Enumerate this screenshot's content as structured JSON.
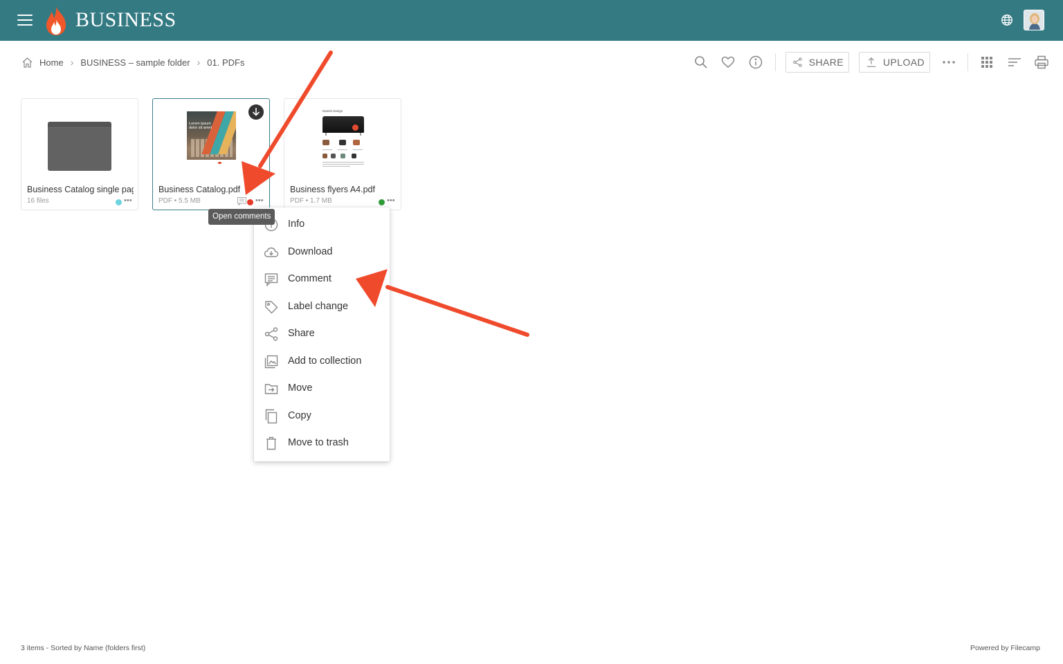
{
  "header": {
    "brand": "BUSINESS",
    "menu_icon": "hamburger-menu-icon",
    "logo_icon": "flame-logo-icon",
    "language_icon": "globe-icon",
    "colors": {
      "bar": "#347a83",
      "flame_outer": "#f0572a",
      "flame_inner": "#ffffff"
    }
  },
  "breadcrumb": {
    "items": [
      "Home",
      "BUSINESS – sample folder",
      "01. PDFs"
    ],
    "separator_icon": "chevron-right-icon"
  },
  "toolbar": {
    "share_label": "SHARE",
    "upload_label": "UPLOAD",
    "icons": [
      "search-icon",
      "heart-icon",
      "info-icon",
      "share-icon",
      "upload-icon",
      "more-horizontal-icon",
      "grid-view-icon",
      "sort-icon",
      "print-icon"
    ]
  },
  "files": [
    {
      "name": "Business Catalog single page",
      "meta": "16 files",
      "kind": "folder",
      "status_color": "#6dd4e0"
    },
    {
      "name": "Business Catalog.pdf",
      "meta": "PDF • 5.5 MB",
      "kind": "pdf",
      "status_color": "#e53a28",
      "selected": true
    },
    {
      "name": "Business flyers A4.pdf",
      "meta": "PDF • 1.7 MB",
      "kind": "pdf",
      "status_color": "#2e9b3a"
    }
  ],
  "catalog_cover_text": [
    "Lorem ipsum",
    "dolor sit amet"
  ],
  "flyer_header": "Danish Design",
  "tooltip": "Open comments",
  "context_menu": {
    "items": [
      {
        "label": "Info",
        "icon": "info-icon"
      },
      {
        "label": "Download",
        "icon": "cloud-download-icon"
      },
      {
        "label": "Comment",
        "icon": "comment-icon"
      },
      {
        "label": "Label change",
        "icon": "tag-icon"
      },
      {
        "label": "Share",
        "icon": "share-icon"
      },
      {
        "label": "Add to collection",
        "icon": "collection-icon"
      },
      {
        "label": "Move",
        "icon": "move-folder-icon"
      },
      {
        "label": "Copy",
        "icon": "copy-icon"
      },
      {
        "label": "Move to trash",
        "icon": "trash-icon"
      }
    ]
  },
  "annotation_color": "#f04a2c",
  "footer": {
    "status": "3 items - Sorted by Name (folders first)",
    "powered": "Powered by Filecamp"
  }
}
